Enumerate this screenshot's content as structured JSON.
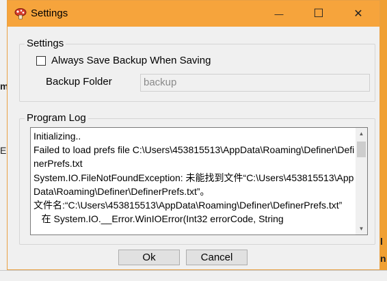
{
  "window": {
    "title": "Settings",
    "minimize_glyph": "—",
    "maximize_glyph": "☐",
    "close_glyph": "✕",
    "icon": "app-icon"
  },
  "settings_group": {
    "label": "Settings",
    "always_save_backup": {
      "label": "Always Save Backup When Saving",
      "checked": false
    },
    "backup_folder": {
      "label": "Backup Folder",
      "value": "backup"
    }
  },
  "log_group": {
    "label": "Program Log",
    "text": "Initializing..\nFailed to load prefs file C:\\Users\\453815513\\AppData\\Roaming\\Definer\\DefinerPrefs.txt\nSystem.IO.FileNotFoundException: 未能找到文件“C:\\Users\\453815513\\AppData\\Roaming\\Definer\\DefinerPrefs.txt”。\n文件名:“C:\\Users\\453815513\\AppData\\Roaming\\Definer\\DefinerPrefs.txt”\n   在 System.IO.__Error.WinIOError(Int32 errorCode, String"
  },
  "buttons": {
    "ok": "Ok",
    "cancel": "Cancel"
  },
  "background_fragments": {
    "left_1": "m",
    "left_2": "E",
    "right_1": "l",
    "right_2": "n"
  },
  "colors": {
    "titlebar": "#f6a43c",
    "dialog_bg": "#f0f0f0",
    "button_bg": "#e1e1e1"
  }
}
